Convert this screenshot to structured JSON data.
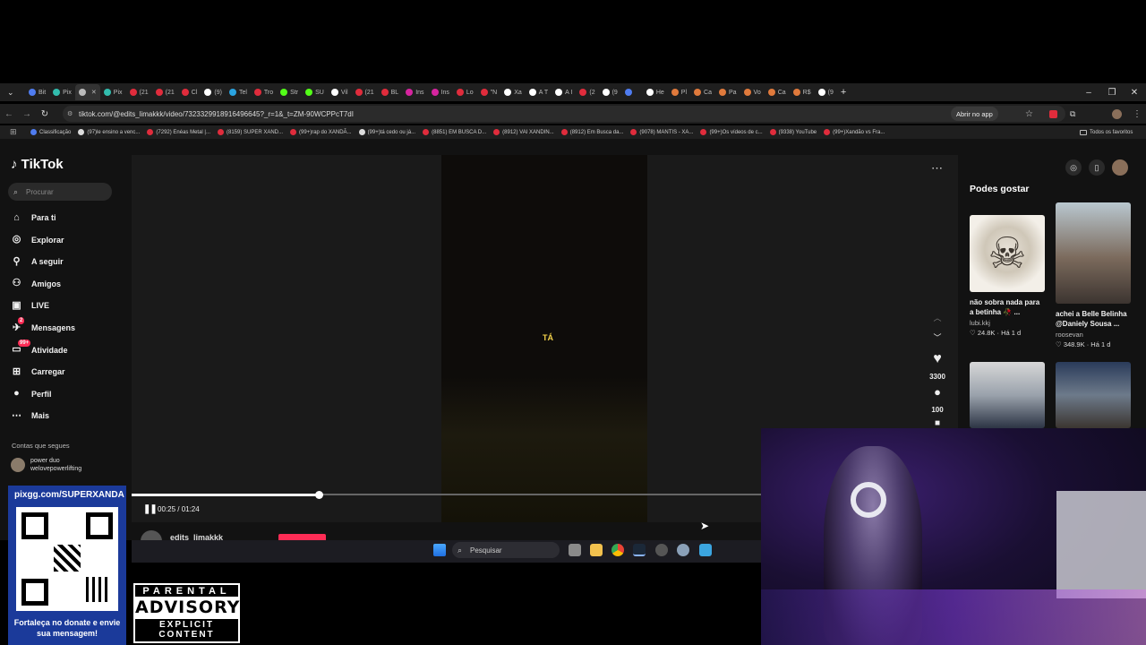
{
  "browser": {
    "tabs": [
      {
        "label": "Bit",
        "color": "#4f7cf0"
      },
      {
        "label": "Pix",
        "color": "#32bcad"
      },
      {
        "label": "",
        "color": "#bbbbbb"
      },
      {
        "label": "Pix",
        "color": "#32bcad"
      },
      {
        "label": "(21",
        "color": "#e02c3c"
      },
      {
        "label": "(21",
        "color": "#e02c3c"
      },
      {
        "label": "Cl",
        "color": "#e02c3c"
      },
      {
        "label": "(9)",
        "color": "#ffffff"
      },
      {
        "label": "Tel",
        "color": "#2aa3e0"
      },
      {
        "label": "Tro",
        "color": "#e02c3c"
      },
      {
        "label": "Str",
        "color": "#53fc18"
      },
      {
        "label": "SU",
        "color": "#53fc18"
      },
      {
        "label": "Vil",
        "color": "#ffffff"
      },
      {
        "label": "(21",
        "color": "#e02c3c"
      },
      {
        "label": "BL",
        "color": "#e02c3c"
      },
      {
        "label": "Ins",
        "color": "#d6249f"
      },
      {
        "label": "Ins",
        "color": "#d6249f"
      },
      {
        "label": "Lo",
        "color": "#e02c3c"
      },
      {
        "label": "\"N",
        "color": "#e02c3c"
      },
      {
        "label": "Xa",
        "color": "#ffffff"
      },
      {
        "label": "A T",
        "color": "#ffffff"
      },
      {
        "label": "A I",
        "color": "#ffffff"
      },
      {
        "label": "(2",
        "color": "#e02c3c"
      },
      {
        "label": "(9",
        "color": "#ffffff"
      },
      {
        "label": "",
        "color": "#4f7cf0"
      },
      {
        "label": "He",
        "color": "#ffffff"
      },
      {
        "label": "Pl",
        "color": "#e07a3c"
      },
      {
        "label": "Ca",
        "color": "#e07a3c"
      },
      {
        "label": "Pa",
        "color": "#e07a3c"
      },
      {
        "label": "Vo",
        "color": "#e07a3c"
      },
      {
        "label": "Ca",
        "color": "#e07a3c"
      },
      {
        "label": "R$",
        "color": "#e07a3c"
      },
      {
        "label": "(9",
        "color": "#ffffff"
      }
    ],
    "url": "tiktok.com/@edits_limakkk/video/7323329918916496645?_r=1&_t=ZM-90WCPPcT7dI",
    "open_app": "Abrir no app",
    "bookmarks": [
      "Classificação",
      "(97)le ensino a venc...",
      "(7292) Enéas Metal |...",
      "(8159) SUPER XAND...",
      "(99+)rap do XANDÃ...",
      "(99+)tá cedo ou já...",
      "(8851) EM BUSCA D...",
      "(8912) VAI XANDIN...",
      "(8912) Em Busca da...",
      "(9078) MANTIS - XA...",
      "(99+)Os vídeos de c...",
      "(9338) YouTube",
      "(99+)Xandão vs Fra..."
    ],
    "all_favorites": "Todos os favoritos"
  },
  "tiktok": {
    "logo": "TikTok",
    "search_placeholder": "Procurar",
    "nav": [
      {
        "label": "Para ti",
        "icon": "home-icon"
      },
      {
        "label": "Explorar",
        "icon": "compass-icon"
      },
      {
        "label": "A seguir",
        "icon": "user-plus-icon"
      },
      {
        "label": "Amigos",
        "icon": "friends-icon"
      },
      {
        "label": "LIVE",
        "icon": "live-icon"
      },
      {
        "label": "Mensagens",
        "icon": "send-icon"
      },
      {
        "label": "Atividade",
        "icon": "inbox-icon"
      },
      {
        "label": "Carregar",
        "icon": "plus-square-icon"
      },
      {
        "label": "Perfil",
        "icon": "profile-icon"
      },
      {
        "label": "Mais",
        "icon": "more-icon"
      }
    ],
    "badges": {
      "messages": "2",
      "activity": "99+"
    },
    "following_heading": "Contas que segues",
    "following": [
      {
        "name": "power duo",
        "handle": "welovepowerlifting"
      }
    ],
    "video": {
      "subtitle": "TÁ",
      "time": "00:25 / 01:24",
      "progress": 0.298,
      "author": "edits_limakkk",
      "likes": "3300",
      "comments": "100"
    },
    "suggested_heading": "Podes gostar",
    "suggested": [
      {
        "caption": "não sobra nada para a betinha 🥀 ...",
        "user": "lubi.kkj",
        "likes": "24.8K",
        "age": "Há 1 d"
      },
      {
        "caption": "achei a Belle Belinha @Daniely Sousa ...",
        "user": "roosevan",
        "likes": "348.9K",
        "age": "Há 1 d"
      }
    ]
  },
  "taskbar": {
    "search_placeholder": "Pesquisar"
  },
  "overlay": {
    "pix_url": "pixgg.com/SUPERXANDA",
    "pix_message": "Fortaleça no donate e envie sua mensagem!",
    "advisory_top": "PARENTAL",
    "advisory_mid": "ADVISORY",
    "advisory_bottom": "EXPLICIT CONTENT"
  }
}
